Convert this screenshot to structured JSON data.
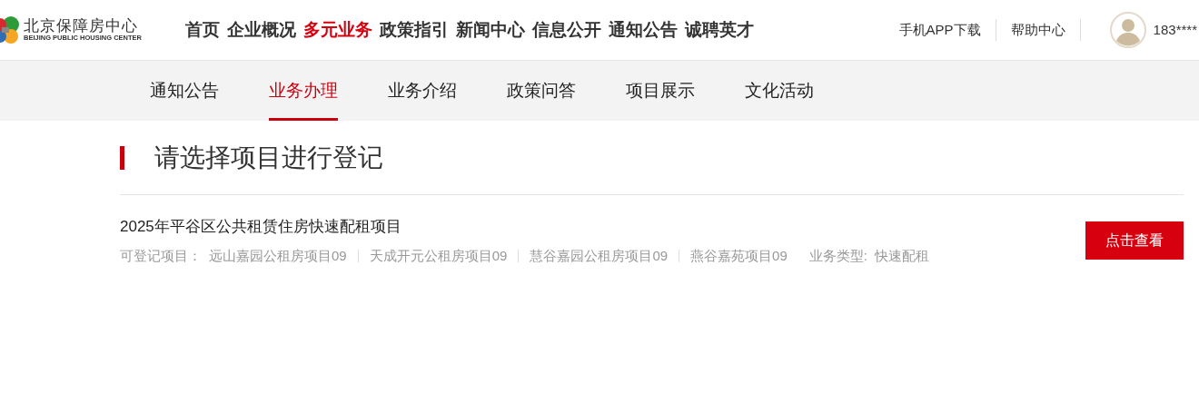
{
  "logo": {
    "title": "北京保障房中心",
    "subtitle": "BEIJING PUBLIC HOUSING CENTER"
  },
  "main_nav": [
    {
      "label": "首页",
      "selected": false
    },
    {
      "label": "企业概况",
      "selected": false
    },
    {
      "label": "多元业务",
      "selected": true
    },
    {
      "label": "政策指引",
      "selected": false
    },
    {
      "label": "新闻中心",
      "selected": false
    },
    {
      "label": "信息公开",
      "selected": false
    },
    {
      "label": "通知公告",
      "selected": false
    },
    {
      "label": "诚聘英才",
      "selected": false
    }
  ],
  "header_links": [
    "手机APP下载",
    "帮助中心"
  ],
  "user": {
    "name": "183****"
  },
  "sub_nav": [
    {
      "label": "通知公告",
      "selected": false
    },
    {
      "label": "业务办理",
      "selected": true
    },
    {
      "label": "业务介绍",
      "selected": false
    },
    {
      "label": "政策问答",
      "selected": false
    },
    {
      "label": "项目展示",
      "selected": false
    },
    {
      "label": "文化活动",
      "selected": false
    }
  ],
  "section_title": "请选择项目进行登记",
  "projects": [
    {
      "title": "2025年平谷区公共租赁住房快速配租项目",
      "items_label": "可登记项目：",
      "items": [
        "远山嘉园公租房项目09",
        "天成开元公租房项目09",
        "慧谷嘉园公租房项目09",
        "燕谷嘉苑项目09"
      ],
      "type_label": "业务类型:",
      "type_value": "快速配租",
      "button": "点击查看"
    }
  ]
}
